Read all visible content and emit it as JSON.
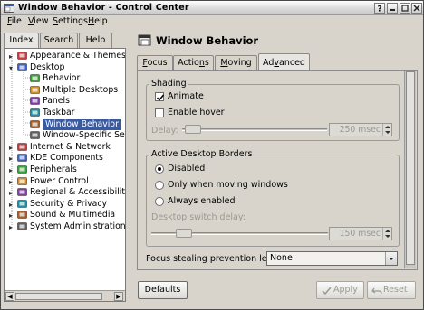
{
  "window": {
    "title": "Window Behavior - Control Center"
  },
  "menu": [
    {
      "label": "File",
      "mnemonic": "F",
      "rest": "ile"
    },
    {
      "label": "View",
      "mnemonic": "V",
      "rest": "iew"
    },
    {
      "label": "Settings",
      "mnemonic": "S",
      "rest": "ettings"
    },
    {
      "label": "Help",
      "mnemonic": "H",
      "rest": "elp"
    }
  ],
  "left_tabs": [
    {
      "label": "Index",
      "active": true
    },
    {
      "label": "Search",
      "active": false
    },
    {
      "label": "Help",
      "active": false
    }
  ],
  "tree": {
    "items": [
      {
        "label": "Appearance & Themes",
        "level": 0,
        "expanded": false,
        "icon": "appearance-icon"
      },
      {
        "label": "Desktop",
        "level": 0,
        "expanded": true,
        "icon": "desktop-icon"
      },
      {
        "label": "Behavior",
        "level": 1,
        "icon": "behavior-icon"
      },
      {
        "label": "Multiple Desktops",
        "level": 1,
        "icon": "multiple-desktops-icon"
      },
      {
        "label": "Panels",
        "level": 1,
        "icon": "panels-icon"
      },
      {
        "label": "Taskbar",
        "level": 1,
        "icon": "taskbar-icon"
      },
      {
        "label": "Window Behavior",
        "level": 1,
        "icon": "window-behavior-icon",
        "selected": true
      },
      {
        "label": "Window-Specific Sett",
        "level": 1,
        "icon": "window-specific-icon"
      },
      {
        "label": "Internet & Network",
        "level": 0,
        "expanded": false,
        "icon": "internet-icon"
      },
      {
        "label": "KDE Components",
        "level": 0,
        "expanded": false,
        "icon": "kde-components-icon"
      },
      {
        "label": "Peripherals",
        "level": 0,
        "expanded": false,
        "icon": "peripherals-icon"
      },
      {
        "label": "Power Control",
        "level": 0,
        "expanded": false,
        "icon": "power-icon"
      },
      {
        "label": "Regional & Accessibility",
        "level": 0,
        "expanded": false,
        "icon": "regional-icon"
      },
      {
        "label": "Security & Privacy",
        "level": 0,
        "expanded": false,
        "icon": "security-icon"
      },
      {
        "label": "Sound & Multimedia",
        "level": 0,
        "expanded": false,
        "icon": "sound-icon"
      },
      {
        "label": "System Administration",
        "level": 0,
        "expanded": false,
        "icon": "system-admin-icon"
      }
    ]
  },
  "header": {
    "title": "Window Behavior",
    "icon": "window-behavior-icon"
  },
  "tabs": [
    {
      "label": "Focus",
      "mnemonic": "F",
      "rest": "ocus",
      "active": false
    },
    {
      "label": "Actions",
      "mnemonic": "",
      "pre": "Actio",
      "mid": "n",
      "post": "s",
      "active": false
    },
    {
      "label": "Moving",
      "mnemonic": "M",
      "rest": "oving",
      "active": false
    },
    {
      "label": "Advanced",
      "mnemonic": "",
      "pre": "Ad",
      "mid": "v",
      "post": "anced",
      "active": true
    }
  ],
  "shading": {
    "title": "Shading",
    "animate": {
      "label": "Animate",
      "checked": true
    },
    "enable_hover": {
      "label": "Enable hover",
      "checked": false
    },
    "delay": {
      "label": "Delay:",
      "value": "250 msec",
      "enabled": false
    }
  },
  "borders": {
    "title": "Active Desktop Borders",
    "options": [
      {
        "label": "Disabled",
        "selected": true
      },
      {
        "label": "Only when moving windows",
        "selected": false
      },
      {
        "label": "Always enabled",
        "selected": false
      }
    ],
    "switch_delay": {
      "label": "Desktop switch delay:",
      "value": "150 msec",
      "enabled": false
    }
  },
  "focus_stealing": {
    "label": "Focus stealing prevention level:",
    "value": "None"
  },
  "buttons": {
    "defaults": "Defaults",
    "apply": "Apply",
    "reset": "Reset"
  },
  "colors": {
    "selection": "#3a5aa0",
    "background": "#d8d4cc",
    "disabled_text": "#9a9890"
  }
}
